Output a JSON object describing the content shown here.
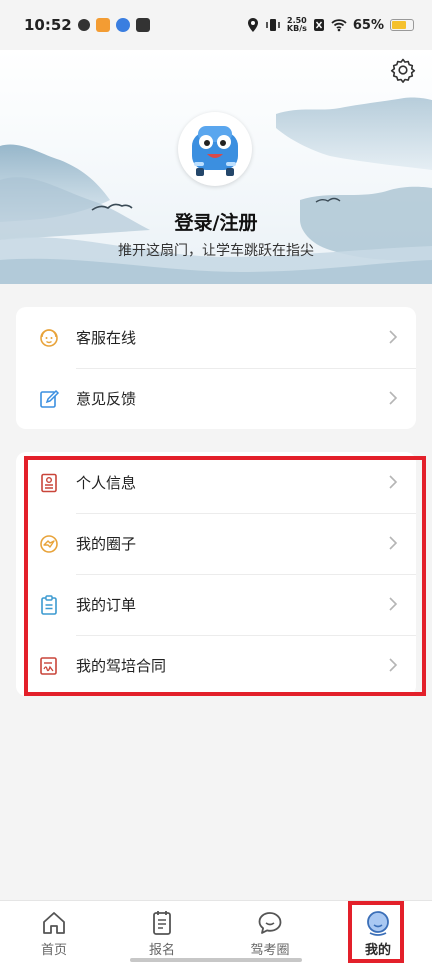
{
  "status_bar": {
    "time": "10:52",
    "speed_value": "2.50",
    "speed_unit": "KB/s",
    "battery": "65%"
  },
  "header": {
    "login_title": "登录/注册",
    "login_subtitle": "推开这扇门，让学车跳跃在指尖"
  },
  "menu_group_1": [
    {
      "label": "客服在线",
      "icon": "customer-service-icon"
    },
    {
      "label": "意见反馈",
      "icon": "feedback-edit-icon"
    }
  ],
  "menu_group_2": [
    {
      "label": "个人信息",
      "icon": "id-card-icon"
    },
    {
      "label": "我的圈子",
      "icon": "circle-icon"
    },
    {
      "label": "我的订单",
      "icon": "clipboard-icon"
    },
    {
      "label": "我的驾培合同",
      "icon": "contract-icon"
    }
  ],
  "tabs": [
    {
      "label": "首页",
      "icon": "home-icon",
      "active": false
    },
    {
      "label": "报名",
      "icon": "register-icon",
      "active": false
    },
    {
      "label": "驾考圈",
      "icon": "chat-bubble-icon",
      "active": false
    },
    {
      "label": "我的",
      "icon": "profile-icon",
      "active": true
    }
  ],
  "colors": {
    "highlight": "#e3202a",
    "accent_blue": "#3b8fe0",
    "icon_orange": "#e8a33a",
    "icon_red": "#c9453a"
  }
}
